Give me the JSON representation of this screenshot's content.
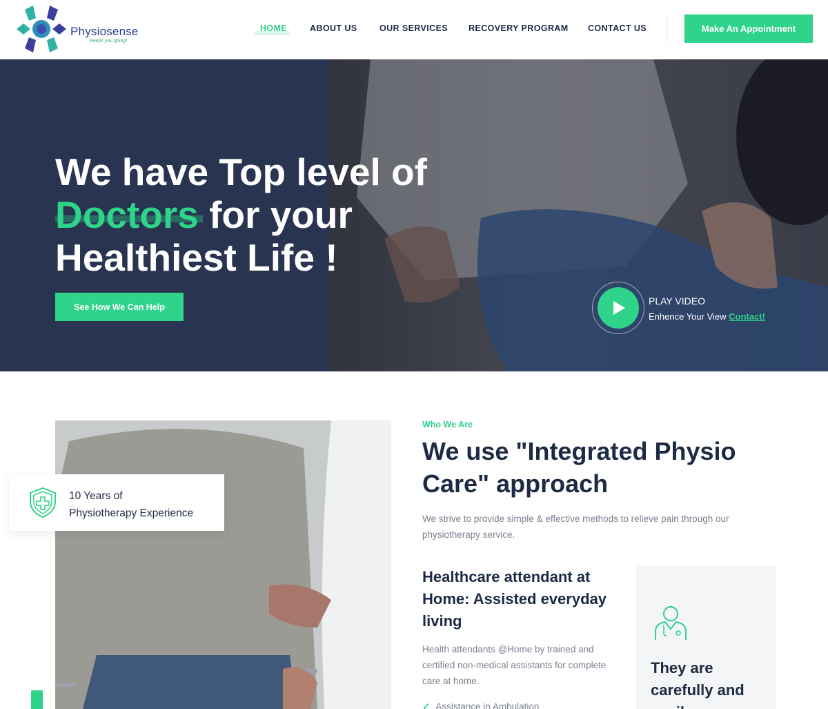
{
  "brand": {
    "name": "Physiosense",
    "tagline": "Keeps you going!",
    "accent": "#2fd38a",
    "navy": "#293450"
  },
  "nav": {
    "items": [
      {
        "label": "HOME",
        "active": true
      },
      {
        "label": "ABOUT US",
        "active": false
      },
      {
        "label": "OUR SERVICES",
        "active": false
      },
      {
        "label": "RECOVERY PROGRAM",
        "active": false
      },
      {
        "label": "CONTACT US",
        "active": false
      }
    ],
    "cta": "Make An Appointment"
  },
  "hero": {
    "line1": "We have Top level of",
    "accent_word": "Doctors",
    "line2_rest": " for your",
    "line3": "Healthiest Life !",
    "button": "See How We Can Help",
    "video": {
      "title": "PLAY VIDEO",
      "subtitle": "Enhence Your View ",
      "link": "Contact!",
      "icon": "play-icon"
    }
  },
  "experience_card": {
    "line1": "10 Years of",
    "line2": "Physiotherapy Experience",
    "icon": "shield-plus-icon"
  },
  "about": {
    "eyebrow": "Who We Are",
    "title": "We use \"Integrated Physio Care\" approach",
    "description": "We strive to provide simple & effective methods to relieve pain through our physiotherapy service."
  },
  "healthcare": {
    "title": "Healthcare attendant at Home: Assisted everyday living",
    "description": "Health attendants @Home by trained and certified non-medical assistants for complete care at home.",
    "items": [
      "Assistance in Ambulation"
    ]
  },
  "side_card": {
    "icon": "doctor-icon",
    "text": "They are carefully and easily manage"
  }
}
